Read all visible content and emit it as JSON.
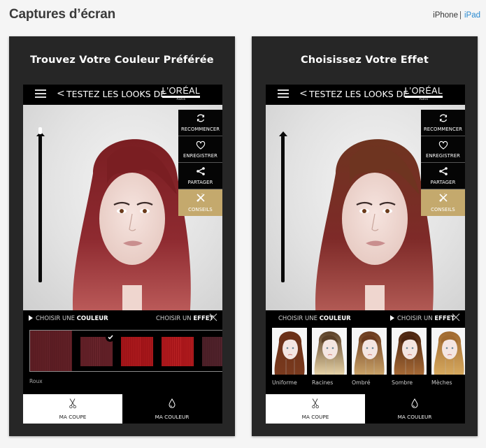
{
  "page": {
    "title": "Captures d’écran",
    "device_switch": {
      "iphone": "iPhone",
      "separator": "|",
      "ipad": "iPad",
      "active": "iPad"
    }
  },
  "colors": {
    "accent_link": "#2a8ad1",
    "gold": "#c4a96d",
    "card_bg": "#262626"
  },
  "screenshots": [
    {
      "caption": "Trouvez Votre Couleur Préférée",
      "navbar": {
        "menu_icon": "hamburger-icon",
        "back_icon": "chevron-left-icon",
        "back_glyph": "<",
        "title": "TESTEZ LES LOOKS DE",
        "logo": {
          "brand": "L’ORÉAL",
          "line2": "PROFESSIONNEL",
          "line3": "PARIS"
        }
      },
      "slider": {
        "value": 1.0
      },
      "side_actions": [
        {
          "label": "RECOMMENCER",
          "icon": "refresh-icon"
        },
        {
          "label": "ENREGISTRER",
          "icon": "heart-icon"
        },
        {
          "label": "PARTAGER",
          "icon": "share-icon"
        },
        {
          "label": "CONSEILS",
          "icon": "tools-icon",
          "highlighted": true
        }
      ],
      "panel": {
        "tab_color_prefix": "CHOISIR UNE ",
        "tab_color_bold": "COULEUR",
        "tab_effect_prefix": "CHOISIR UN ",
        "tab_effect_bold": "EFFET",
        "active_tab": "couleur"
      },
      "swatches": {
        "family_label": "Roux",
        "items": [
          {
            "color": "#5a1c22",
            "highlight": "#7a3038"
          },
          {
            "color": "#5e1e25",
            "highlight": "#84363e",
            "selected": true
          },
          {
            "color": "#a01418",
            "highlight": "#d03030"
          },
          {
            "color": "#a8161a",
            "highlight": "#d83a36"
          },
          {
            "color": "#4a1e26",
            "highlight": "#6a3440"
          }
        ]
      },
      "bottom_tabs": [
        {
          "label": "MA COUPE",
          "icon": "scissors-icon",
          "active": true
        },
        {
          "label": "MA COULEUR",
          "icon": "drop-icon",
          "active": false
        }
      ],
      "hair": {
        "top": "#7a1e22",
        "mid": "#8e2a30",
        "tips": "#c0605e"
      }
    },
    {
      "caption": "Choisissez Votre Effet",
      "navbar": {
        "menu_icon": "hamburger-icon",
        "back_icon": "chevron-left-icon",
        "back_glyph": "<",
        "title": "TESTEZ LES LOOKS DE",
        "logo": {
          "brand": "L’ORÉAL",
          "line2": "PROFESSIONNEL",
          "line3": "PARIS"
        }
      },
      "slider": {
        "value": 1.0
      },
      "side_actions": [
        {
          "label": "RECOMMENCER",
          "icon": "refresh-icon"
        },
        {
          "label": "ENREGISTRER",
          "icon": "heart-icon"
        },
        {
          "label": "PARTAGER",
          "icon": "share-icon"
        },
        {
          "label": "CONSEILS",
          "icon": "tools-icon",
          "highlighted": true
        }
      ],
      "panel": {
        "tab_color_prefix": "CHOISIR UNE ",
        "tab_color_bold": "COULEUR",
        "tab_effect_prefix": "CHOISIR UN ",
        "tab_effect_bold": "EFFET",
        "active_tab": "effet"
      },
      "effects": [
        {
          "label": "Uniforme",
          "root": "#6a3018",
          "tip": "#7a3a1e"
        },
        {
          "label": "Racines",
          "root": "#5a4028",
          "tip": "#e6d2a6"
        },
        {
          "label": "Ombré",
          "root": "#6a3a1e",
          "tip": "#c9a268"
        },
        {
          "label": "Sombre",
          "root": "#4a2410",
          "tip": "#a66a36"
        },
        {
          "label": "Mèches",
          "root": "#a06a30",
          "tip": "#d6a85e"
        }
      ],
      "bottom_tabs": [
        {
          "label": "MA COUPE",
          "icon": "scissors-icon",
          "active": true
        },
        {
          "label": "MA COULEUR",
          "icon": "drop-icon",
          "active": false
        }
      ],
      "hair": {
        "top": "#6e3420",
        "mid": "#7e2a28",
        "tips": "#b8605a"
      }
    }
  ]
}
